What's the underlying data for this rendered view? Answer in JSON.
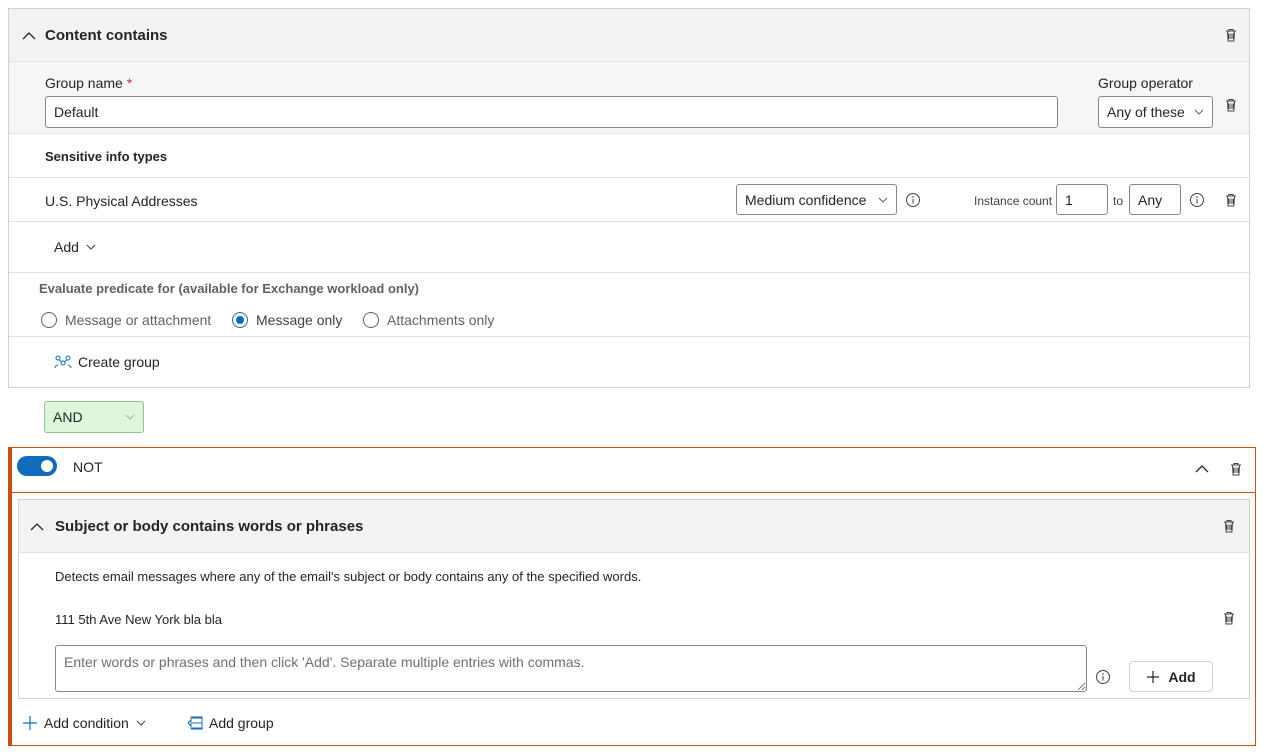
{
  "content_contains": {
    "title": "Content contains",
    "group_name_label": "Group name",
    "required_mark": "*",
    "group_name_value": "Default",
    "group_operator_label": "Group operator",
    "group_operator_value": "Any of these",
    "sensitive_info_types_label": "Sensitive info types",
    "sit_item": {
      "name": "U.S. Physical Addresses",
      "confidence": "Medium confidence",
      "instance_count_label": "Instance count",
      "instance_min": "1",
      "to_label": "to",
      "instance_max": "Any"
    },
    "add_label": "Add",
    "evaluate_label": "Evaluate predicate for (available for Exchange workload only)",
    "radio_options": [
      {
        "label": "Message or attachment",
        "checked": false
      },
      {
        "label": "Message only",
        "checked": true
      },
      {
        "label": "Attachments only",
        "checked": false
      }
    ],
    "create_group_label": "Create group"
  },
  "operator_button": "AND",
  "not_group": {
    "toggle_on": true,
    "label": "NOT",
    "subject_card": {
      "title": "Subject or body contains words or phrases",
      "description": "Detects email messages where any of the email's subject or body contains any of the specified words.",
      "entries": [
        "111 5th Ave New York bla bla"
      ],
      "input_placeholder": "Enter words or phrases and then click 'Add'. Separate multiple entries with commas.",
      "add_button": "Add"
    },
    "add_condition_label": "Add condition",
    "add_group_label": "Add group"
  },
  "colors": {
    "accent": "#0f6cbd",
    "not_border": "#ca5010",
    "and_bg": "#dff6dd",
    "header_bg": "#f3f3f3"
  }
}
